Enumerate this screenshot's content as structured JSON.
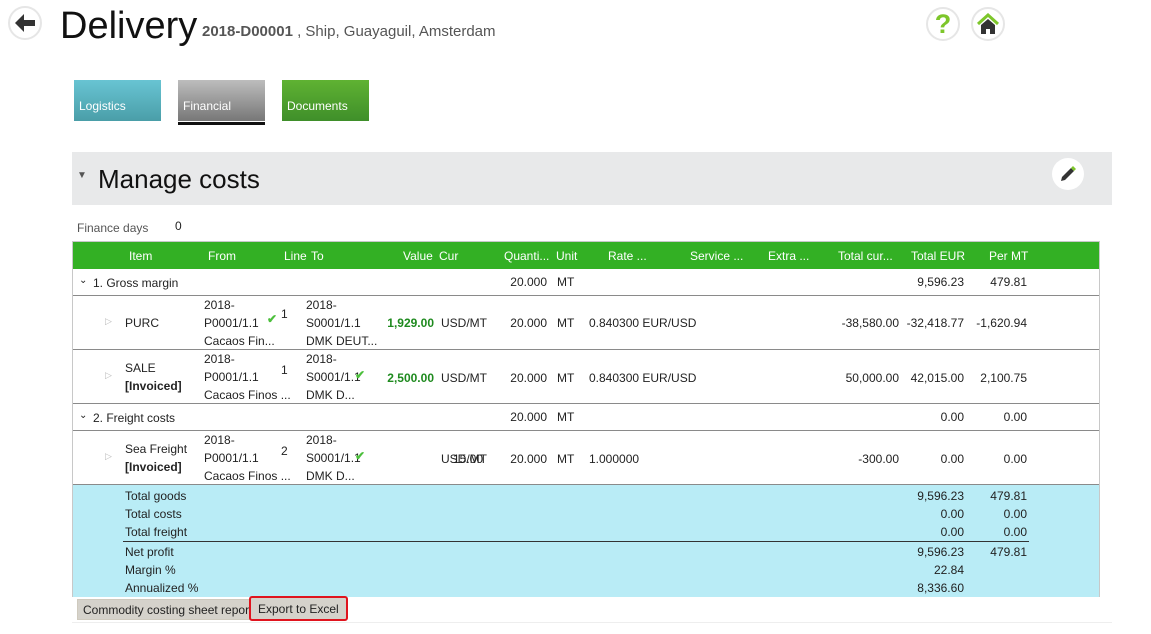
{
  "header": {
    "title": "Delivery",
    "delivery_id": "2018-D00001",
    "subtitle": " , Ship, Guayaguil, Amsterdam",
    "icons": [
      "back-arrow-icon",
      "help-icon",
      "home-icon"
    ]
  },
  "tabs": [
    {
      "label": "Logistics",
      "color": "#4fb0c0"
    },
    {
      "label": "Financial",
      "color": "#8c8c8c",
      "active": true
    },
    {
      "label": "Documents",
      "color": "#46a02e"
    }
  ],
  "section": {
    "title": "Manage costs",
    "edit_icon": "pencil-icon"
  },
  "finance_days": {
    "label": "Finance days",
    "value": "0"
  },
  "table": {
    "columns": [
      "Item",
      "From",
      "Line",
      "To",
      "Value",
      "Cur",
      "Quanti...",
      "Unit",
      "Rate ...",
      "Service ...",
      "Extra ...",
      "Total cur...",
      "Total EUR",
      "Per MT"
    ],
    "groups": [
      {
        "label": "1. Gross margin",
        "quantity": "20.000",
        "unit": "MT",
        "total_eur": "9,596.23",
        "per_mt": "479.81",
        "rows": [
          {
            "item": "PURC",
            "status": "",
            "from": [
              "2018-",
              "P0001/1.1",
              "Cacaos Fin..."
            ],
            "from_check": true,
            "line": "1",
            "to": [
              "2018-",
              "S0001/1.1",
              "DMK DEUT..."
            ],
            "to_check": false,
            "value": "1,929.00",
            "cur": "USD/MT",
            "quantity": "20.000",
            "unit": "MT",
            "rate": "0.840300 EUR/USD",
            "total_cur": "-38,580.00",
            "total_eur": "-32,418.77",
            "per_mt": "-1,620.94"
          },
          {
            "item": "SALE",
            "status": "[Invoiced]",
            "from": [
              "2018-",
              "P0001/1.1",
              "Cacaos Finos ..."
            ],
            "from_check": false,
            "line": "1",
            "to": [
              "2018-",
              "S0001/1.1",
              "DMK D..."
            ],
            "to_check": true,
            "value": "2,500.00",
            "cur": "USD/MT",
            "quantity": "20.000",
            "unit": "MT",
            "rate": "0.840300 EUR/USD",
            "total_cur": "50,000.00",
            "total_eur": "42,015.00",
            "per_mt": "2,100.75"
          }
        ]
      },
      {
        "label": "2. Freight costs",
        "quantity": "20.000",
        "unit": "MT",
        "total_eur": "0.00",
        "per_mt": "0.00",
        "rows": [
          {
            "item": "Sea Freight",
            "status": "[Invoiced]",
            "from": [
              "2018-",
              "P0001/1.1",
              "Cacaos Finos ..."
            ],
            "from_check": false,
            "line": "2",
            "to": [
              "2018-",
              "S0001/1.1",
              "DMK D..."
            ],
            "to_check": true,
            "value": "15.00",
            "cur": "USD/MT",
            "quantity": "20.000",
            "unit": "MT",
            "rate": "1.000000",
            "total_cur": "-300.00",
            "total_eur": "0.00",
            "per_mt": "0.00"
          }
        ]
      }
    ],
    "summary": [
      {
        "label": "Total goods",
        "total_eur": "9,596.23",
        "per_mt": "479.81"
      },
      {
        "label": "Total costs",
        "total_eur": "0.00",
        "per_mt": "0.00"
      },
      {
        "label": "Total freight",
        "total_eur": "0.00",
        "per_mt": "0.00"
      },
      {
        "label": "Net profit",
        "total_eur": "9,596.23",
        "per_mt": "479.81"
      },
      {
        "label": "Margin %",
        "total_eur": "22.84",
        "per_mt": ""
      },
      {
        "label": "Annualized %",
        "total_eur": "8,336.60",
        "per_mt": ""
      }
    ]
  },
  "buttons": {
    "report": "Commodity costing sheet report",
    "export": "Export to Excel"
  },
  "colors": {
    "header_green": "#33b024",
    "summary_bg": "#b9ecf6",
    "highlight": "#e0141e"
  }
}
